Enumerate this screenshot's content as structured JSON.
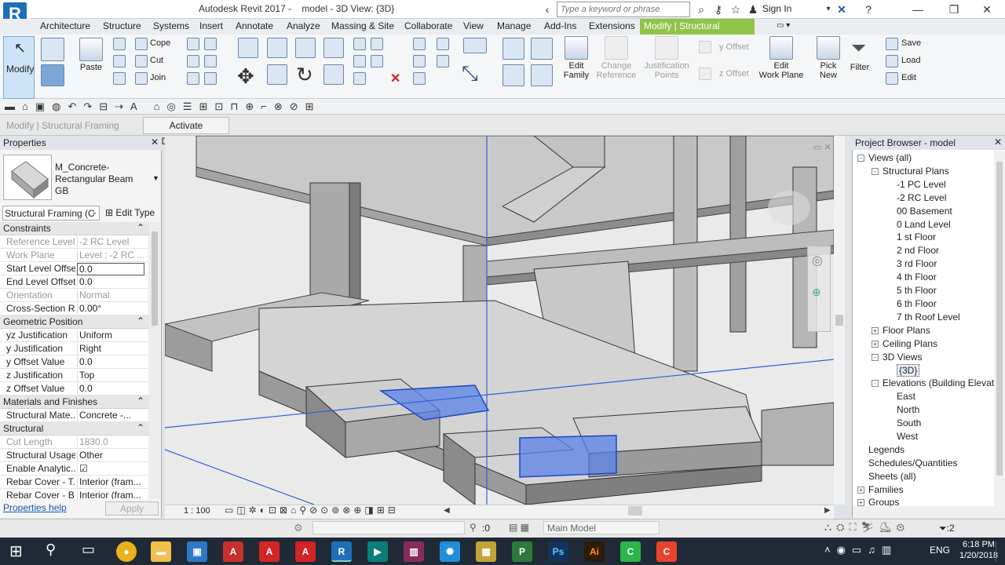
{
  "title_bar": {
    "app": "Autodesk Revit 2017 -",
    "doc": "model - 3D View: {3D}",
    "search_placeholder": "Type a keyword or phrase",
    "sign_in": "Sign In"
  },
  "menu_tabs": [
    "Architecture",
    "Structure",
    "Systems",
    "Insert",
    "Annotate",
    "Analyze",
    "Massing & Site",
    "Collaborate",
    "View",
    "Manage",
    "Add-Ins",
    "Extensions",
    "Modify | Structural Framing"
  ],
  "ribbon": {
    "modify": "Modify",
    "paste": "Paste",
    "cope": "Cope",
    "cut": "Cut",
    "join": "Join",
    "edit_family": [
      "Edit",
      "Family"
    ],
    "change_reference": [
      "Change",
      "Reference"
    ],
    "justification_points": [
      "Justification",
      "Points"
    ],
    "y_offset": "y Offset",
    "z_offset": "z Offset",
    "edit_work_plane": [
      "Edit",
      "Work Plane"
    ],
    "pick_new": [
      "Pick",
      "New"
    ],
    "filter": "Filter",
    "save": "Save",
    "load": "Load",
    "edit": "Edit"
  },
  "options_bar": {
    "context": "Modify | Structural Framing",
    "activate_dimensions": "Activate Dimensions"
  },
  "properties": {
    "title": "Properties",
    "family": "M_Concrete-Rectangular Beam",
    "type": "GB",
    "filter": "Structural Framing (C",
    "edit_type": "Edit Type",
    "sections": [
      {
        "name": "Constraints",
        "rows": [
          [
            "Reference Level",
            "-2 RC Level",
            true
          ],
          [
            "Work Plane",
            "Level : -2 RC ...",
            true
          ],
          [
            "Start Level Offset",
            "0.0",
            false
          ],
          [
            "End Level Offset",
            "0.0",
            false
          ],
          [
            "Orientation",
            "Normal",
            true
          ],
          [
            "Cross-Section R...",
            "0.00°",
            false
          ]
        ]
      },
      {
        "name": "Geometric Position",
        "rows": [
          [
            "yz Justification",
            "Uniform",
            false
          ],
          [
            "y Justification",
            "Right",
            false
          ],
          [
            "y Offset Value",
            "0.0",
            false
          ],
          [
            "z Justification",
            "Top",
            false
          ],
          [
            "z Offset Value",
            "0.0",
            false
          ]
        ]
      },
      {
        "name": "Materials and Finishes",
        "rows": [
          [
            "Structural Mate...",
            "Concrete -...",
            false
          ]
        ]
      },
      {
        "name": "Structural",
        "rows": [
          [
            "Cut Length",
            "1830.0",
            true
          ],
          [
            "Structural Usage",
            "Other",
            false
          ],
          [
            "Enable Analytic...",
            "☑",
            false
          ],
          [
            "Rebar Cover - T...",
            "Interior (fram...",
            false
          ],
          [
            "Rebar Cover - B...",
            "Interior (fram...",
            false
          ]
        ]
      }
    ],
    "help": "Properties help",
    "apply": "Apply"
  },
  "view": {
    "scale": "1 : 100"
  },
  "project_browser": {
    "title": "Project Browser - model",
    "items": [
      {
        "l": "Views (all)",
        "d": 0,
        "e": "-"
      },
      {
        "l": "Structural Plans",
        "d": 1,
        "e": "-"
      },
      {
        "l": "-1 PC Level",
        "d": 2,
        "e": ""
      },
      {
        "l": "-2 RC Level",
        "d": 2,
        "e": ""
      },
      {
        "l": "00 Basement",
        "d": 2,
        "e": ""
      },
      {
        "l": "0 Land Level",
        "d": 2,
        "e": ""
      },
      {
        "l": "1 st Floor",
        "d": 2,
        "e": ""
      },
      {
        "l": "2 nd Floor",
        "d": 2,
        "e": ""
      },
      {
        "l": "3 rd Floor",
        "d": 2,
        "e": ""
      },
      {
        "l": "4 th Floor",
        "d": 2,
        "e": ""
      },
      {
        "l": "5 th Floor",
        "d": 2,
        "e": ""
      },
      {
        "l": "6 th Floor",
        "d": 2,
        "e": ""
      },
      {
        "l": "7 th Roof Level",
        "d": 2,
        "e": ""
      },
      {
        "l": "Floor Plans",
        "d": 1,
        "e": "+"
      },
      {
        "l": "Ceiling Plans",
        "d": 1,
        "e": "+"
      },
      {
        "l": "3D Views",
        "d": 1,
        "e": "-"
      },
      {
        "l": "{3D}",
        "d": 2,
        "e": "",
        "sel": true
      },
      {
        "l": "Elevations (Building Elevatic",
        "d": 1,
        "e": "-"
      },
      {
        "l": "East",
        "d": 2,
        "e": ""
      },
      {
        "l": "North",
        "d": 2,
        "e": ""
      },
      {
        "l": "South",
        "d": 2,
        "e": ""
      },
      {
        "l": "West",
        "d": 2,
        "e": ""
      },
      {
        "l": "Legends",
        "d": 0,
        "e": ""
      },
      {
        "l": "Schedules/Quantities",
        "d": 0,
        "e": ""
      },
      {
        "l": "Sheets (all)",
        "d": 0,
        "e": ""
      },
      {
        "l": "Families",
        "d": 0,
        "e": "+"
      },
      {
        "l": "Groups",
        "d": 0,
        "e": "+"
      }
    ]
  },
  "status": {
    "selection_count": ":0",
    "model": "Main Model",
    "filter_count": ":2"
  },
  "taskbar": {
    "lang": "ENG",
    "time": "6:18 PM",
    "date": "1/20/2018"
  },
  "colors": {
    "context_tab": "#8fc34a",
    "selection": "#2f5fd8",
    "revit": "#1d6fb8"
  }
}
